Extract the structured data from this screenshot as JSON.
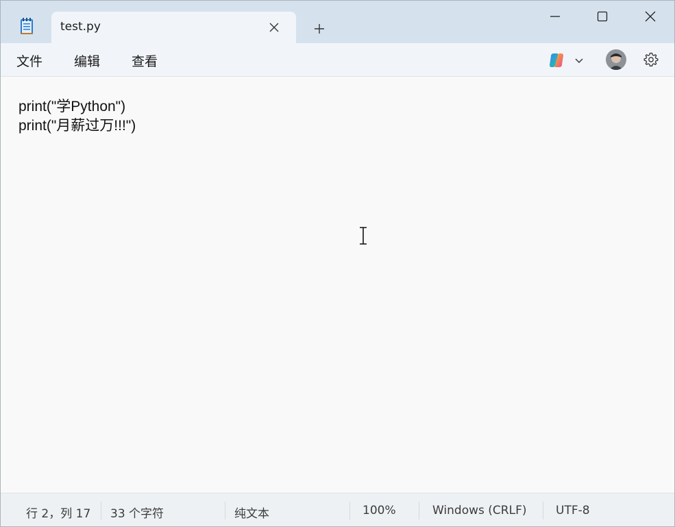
{
  "tab": {
    "title": "test.py"
  },
  "menu": [
    "文件",
    "编辑",
    "查看"
  ],
  "editor": {
    "lines": [
      "print(\"学Python\")",
      "print(\"月薪过万!!!\")"
    ]
  },
  "status": {
    "position": "行 2，列 17",
    "char_count": "33 个字符",
    "format": "纯文本",
    "zoom": "100%",
    "line_ending": "Windows (CRLF)",
    "encoding": "UTF-8"
  },
  "colors": {
    "titlebar": "#d5e2ee",
    "tab_active": "#f1f5f9",
    "editor_bg": "#f9f9f9",
    "statusbar": "#eef1f4"
  },
  "icons": [
    "notepad-icon",
    "close-icon",
    "plus-icon",
    "minimize-icon",
    "maximize-icon",
    "window-close-icon",
    "copilot-icon",
    "chevron-down-icon",
    "gear-icon",
    "text-cursor-icon"
  ]
}
